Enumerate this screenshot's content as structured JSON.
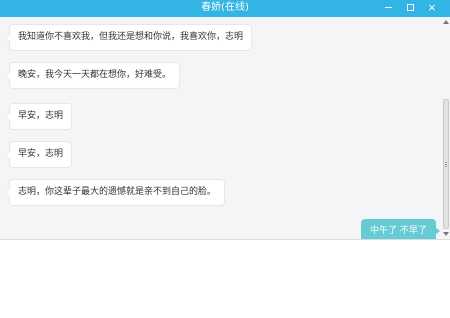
{
  "window": {
    "title": "春娇(在线)",
    "controls": {
      "minimize": "minimize",
      "maximize": "maximize",
      "close": "×"
    },
    "accent_color": "#32b4e5"
  },
  "messages": [
    {
      "direction": "incoming",
      "text": "我知道你不喜欢我，但我还是想和你说，我喜欢你，志明"
    },
    {
      "direction": "incoming",
      "text": "晚安，我今天一天都在想你，好难受。"
    },
    {
      "direction": "incoming",
      "text": "早安，志明"
    },
    {
      "direction": "incoming",
      "text": "早安，志明"
    },
    {
      "direction": "incoming",
      "text": "志明，你这辈子最大的遗憾就是亲不到自己的脸。"
    },
    {
      "direction": "outgoing",
      "text": "中午了 不早了"
    }
  ],
  "colors": {
    "outgoing_bubble": "#66cbd4",
    "incoming_bubble": "#ffffff",
    "chat_background": "#f4f5f7"
  },
  "composer": {
    "value": ""
  }
}
